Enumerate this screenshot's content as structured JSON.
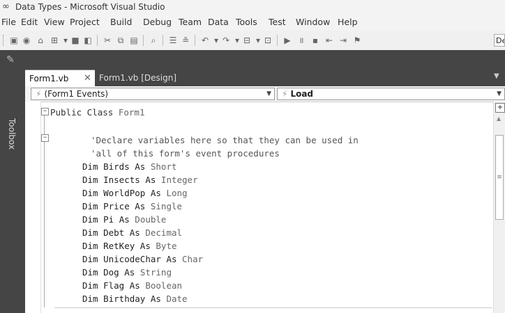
{
  "window": {
    "title": "Data Types - Microsoft Visual Studio"
  },
  "menu": {
    "items": [
      "File",
      "Edit",
      "View",
      "Project",
      "Build",
      "Debug",
      "Team",
      "Data",
      "Tools",
      "Test",
      "Window",
      "Help"
    ]
  },
  "toolbar": {
    "icons": [
      "new-project-icon",
      "add-item-icon",
      "open-file-icon",
      "add-new-item-icon",
      "save-icon",
      "save-all-icon",
      "cut-icon",
      "copy-icon",
      "paste-icon",
      "find-icon",
      "comment-icon",
      "uncomment-icon",
      "undo-icon",
      "redo-icon",
      "navigate-back-icon",
      "start-icon",
      "pause-icon",
      "stop-icon",
      "outdent-icon",
      "indent-icon",
      "bookmark-icon"
    ],
    "combo_stub": "De"
  },
  "toolbox": {
    "label": "Toolbox"
  },
  "tabs": [
    {
      "label": "Form1.vb",
      "active": true
    },
    {
      "label": "Form1.vb [Design]",
      "active": false
    }
  ],
  "nav": {
    "left": "(Form1 Events)",
    "right": "Load"
  },
  "code": {
    "line1_kw": "Public Class",
    "line1_name": "Form1",
    "comment1": "'Declare variables here so that they can be used in",
    "comment2": "'all of this form's event procedures",
    "dims": [
      {
        "kw": "Dim",
        "name": "Birds",
        "as": "As",
        "type": "Short"
      },
      {
        "kw": "Dim",
        "name": "Insects",
        "as": "As",
        "type": "Integer"
      },
      {
        "kw": "Dim",
        "name": "WorldPop",
        "as": "As",
        "type": "Long"
      },
      {
        "kw": "Dim",
        "name": "Price",
        "as": "As",
        "type": "Single"
      },
      {
        "kw": "Dim",
        "name": "Pi",
        "as": "As",
        "type": "Double"
      },
      {
        "kw": "Dim",
        "name": "Debt",
        "as": "As",
        "type": "Decimal"
      },
      {
        "kw": "Dim",
        "name": "RetKey",
        "as": "As",
        "type": "Byte"
      },
      {
        "kw": "Dim",
        "name": "UnicodeChar",
        "as": "As",
        "type": "Char"
      },
      {
        "kw": "Dim",
        "name": "Dog",
        "as": "As",
        "type": "String"
      },
      {
        "kw": "Dim",
        "name": "Flag",
        "as": "As",
        "type": "Boolean"
      },
      {
        "kw": "Dim",
        "name": "Birthday",
        "as": "As",
        "type": "Date"
      }
    ]
  }
}
